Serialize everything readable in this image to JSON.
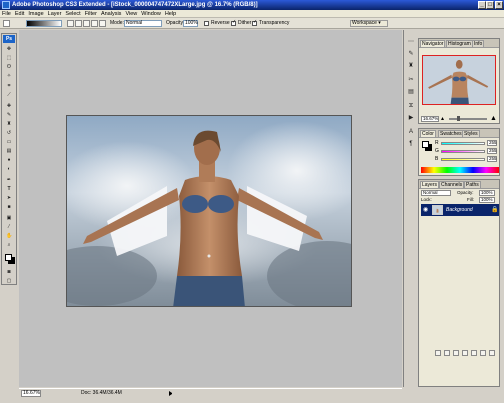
{
  "window": {
    "title": "Adobe Photoshop CS3 Extended - [iStock_000004747472XLarge.jpg @ 16.7% (RGB/8)]",
    "minimize_icon": "minimize-icon",
    "maximize_icon": "maximize-icon",
    "close_icon": "close-icon"
  },
  "menu": [
    "File",
    "Edit",
    "Image",
    "Layer",
    "Select",
    "Filter",
    "Analysis",
    "View",
    "Window",
    "Help"
  ],
  "options_bar": {
    "mode_label": "Mode:",
    "mode_value": "Normal",
    "opacity_label": "Opacity:",
    "opacity_value": "100%",
    "reverse_label": "Reverse",
    "dither_label": "Dither",
    "transparency_label": "Transparency",
    "workspace_label": "Workspace ▾"
  },
  "toolbox": {
    "badge": "Ps",
    "tools": [
      "move-icon",
      "marquee-icon",
      "lasso-icon",
      "magic-wand-icon",
      "crop-icon",
      "slice-icon",
      "healing-brush-icon",
      "brush-icon",
      "clone-stamp-icon",
      "history-brush-icon",
      "eraser-icon",
      "gradient-icon",
      "blur-icon",
      "dodge-icon",
      "pen-icon",
      "type-icon",
      "path-selection-icon",
      "shape-icon",
      "notes-icon",
      "eyedropper-icon",
      "hand-icon",
      "zoom-icon"
    ]
  },
  "status": {
    "zoom": "16.67%",
    "doc_info": "Doc: 36.4M/36.4M"
  },
  "navigator": {
    "tabs": [
      "Navigator",
      "Histogram",
      "Info"
    ],
    "zoom": "16.67%"
  },
  "color": {
    "tabs": [
      "Color",
      "Swatches",
      "Styles"
    ],
    "channels": [
      {
        "label": "R",
        "value": "255",
        "color": "#ff0000"
      },
      {
        "label": "G",
        "value": "255",
        "color": "#00ff00"
      },
      {
        "label": "B",
        "value": "255",
        "color": "#0000ff"
      }
    ]
  },
  "layers": {
    "tabs": [
      "Layers",
      "Channels",
      "Paths"
    ],
    "blend_mode": "Normal",
    "opacity_label": "Opacity:",
    "opacity_value": "100%",
    "lock_label": "Lock:",
    "fill_label": "Fill:",
    "fill_value": "100%",
    "layer_name": "Background"
  },
  "colors": {
    "title_bar": "#0a246a",
    "workspace": "#c0c0c0",
    "selection": "#0a246a"
  }
}
